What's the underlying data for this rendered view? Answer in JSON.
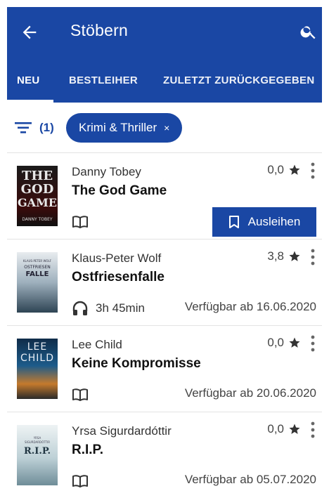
{
  "appbar": {
    "title": "Stöbern",
    "back_icon": "arrow-left-icon",
    "search_icon": "search-icon",
    "color": "#1a47a4"
  },
  "tabs": [
    {
      "label": "NEU",
      "active": true
    },
    {
      "label": "BESTLEIHER",
      "active": false
    },
    {
      "label": "ZULETZT ZURÜCKGEGEBEN",
      "active": false
    }
  ],
  "filter": {
    "icon": "filter-icon",
    "count": "(1)",
    "chip_label": "Krimi & Thriller",
    "chip_close": "×"
  },
  "books": [
    {
      "author": "Danny Tobey",
      "title": "The God Game",
      "rating": "0,0",
      "media_icon": "book-open-icon",
      "action_label": "Ausleihen",
      "cover_text": [
        "THE",
        "GOD",
        "GAME",
        "DANNY TOBEY"
      ]
    },
    {
      "author": "Klaus-Peter Wolf",
      "title": "Ostfriesenfalle",
      "rating": "3,8",
      "media_icon": "headphones-icon",
      "duration": "3h 45min",
      "availability": "Verfügbar ab 16.06.2020",
      "cover_text": [
        "KLAUS-PETER WOLF",
        "OSTFRIESEN",
        "FALLE"
      ]
    },
    {
      "author": "Lee Child",
      "title": "Keine Kompromisse",
      "rating": "0,0",
      "media_icon": "book-open-icon",
      "availability": "Verfügbar ab 20.06.2020",
      "cover_text": [
        "LEE",
        "CHILD"
      ]
    },
    {
      "author": "Yrsa Sigurdardóttir",
      "title": "R.I.P.",
      "rating": "0,0",
      "media_icon": "book-open-icon",
      "availability": "Verfügbar ab 05.07.2020",
      "cover_text": [
        "YRSA",
        "SIGURDARDÓTTIR",
        "R.I.P."
      ]
    }
  ]
}
